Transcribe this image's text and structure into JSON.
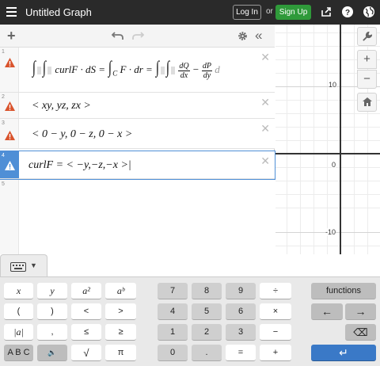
{
  "topbar": {
    "title": "Untitled Graph",
    "login_label": "Log In",
    "or_label": "or",
    "signup_label": "Sign Up",
    "icons": [
      "menu-icon",
      "share-icon",
      "help-icon",
      "globe-icon"
    ]
  },
  "expressions": [
    {
      "num": "1",
      "warning": true,
      "parts": {
        "curl": "curlF · dS =",
        "C": "C",
        "F": "F · dr =",
        "dQ": "dQ",
        "dx": "dx",
        "minus": "−",
        "dP": "dP",
        "dy": "dy",
        "tail": "d"
      }
    },
    {
      "num": "2",
      "warning": true,
      "text": "< xy, yz, zx >"
    },
    {
      "num": "3",
      "warning": true,
      "text": "< 0 − y, 0 − z, 0 − x >"
    },
    {
      "num": "4",
      "warning": true,
      "active": true,
      "text": "curlF = < −y,−z,−x >|"
    },
    {
      "num": "5",
      "text": ""
    }
  ],
  "graph": {
    "y_labels": [
      "10",
      "0",
      "-10"
    ]
  },
  "keypad": {
    "left": [
      [
        "x",
        "y",
        "a²",
        "aᵇ"
      ],
      [
        "(",
        ")",
        "<",
        ">"
      ],
      [
        "|a|",
        ",",
        "≤",
        "≥"
      ],
      [
        "A B C",
        "🔈",
        "√",
        "π"
      ]
    ],
    "middle": [
      [
        "7",
        "8",
        "9",
        "÷"
      ],
      [
        "4",
        "5",
        "6",
        "×"
      ],
      [
        "1",
        "2",
        "3",
        "−"
      ],
      [
        "0",
        ".",
        "=",
        "+"
      ]
    ],
    "functions_label": "functions",
    "left_arrow": "←",
    "right_arrow": "→",
    "backspace": "⌫",
    "enter": "↵"
  },
  "colors": {
    "warning": "#d9532c",
    "active": "#4f8fd6",
    "signup": "#2f9a3a",
    "enter": "#3a79c7"
  }
}
